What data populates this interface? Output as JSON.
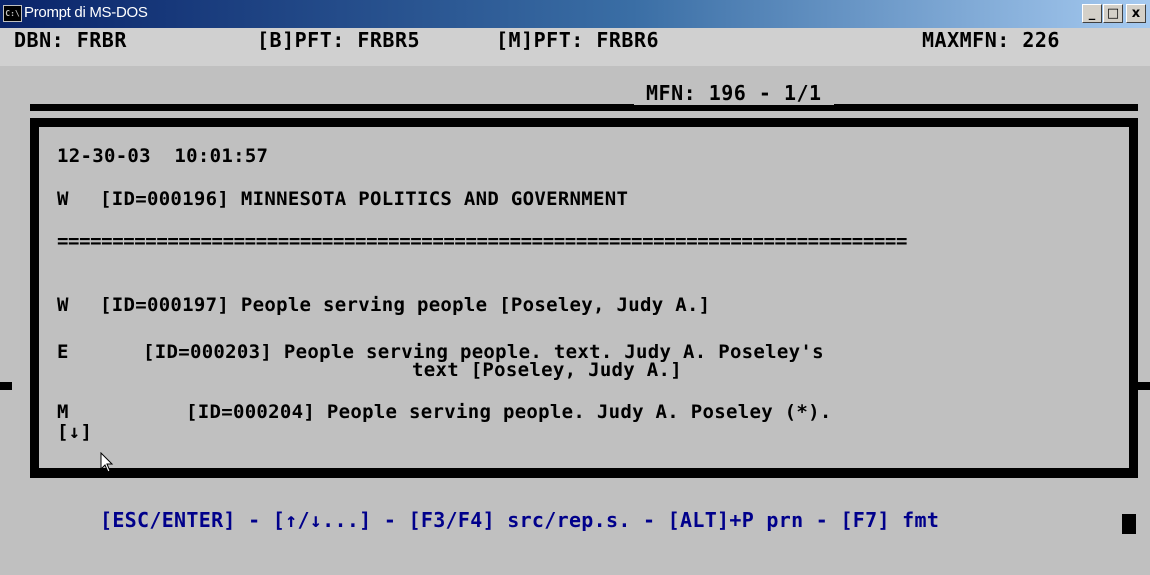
{
  "window": {
    "title": "Prompt di MS-DOS",
    "icon": "msdos-icon",
    "controls": {
      "minimize": "_",
      "maximize": "□",
      "close": "x"
    }
  },
  "header": {
    "dbn": "DBN: FRBR",
    "bpft": "[B]PFT: FRBR5",
    "mpft": "[M]PFT: FRBR6",
    "maxmfn": "MAXMFN: 226"
  },
  "mfn_indicator": "MFN: 196 - 1/1",
  "record": {
    "datetime": "12-30-03  10:01:57",
    "title_type": "W",
    "title_entry": "[ID=000196] MINNESOTA POLITICS AND GOVERNMENT",
    "separator": "=============================================================================",
    "rows": [
      {
        "type": "W",
        "text": "[ID=000197] People serving people [Poseley, Judy A.]"
      },
      {
        "type": "E",
        "text": "[ID=000203] People serving people. text. Judy A. Poseley's",
        "continuation": "text [Poseley, Judy A.]"
      },
      {
        "type": "M",
        "text": "[ID=000204] People serving people. Judy A. Poseley (*)."
      }
    ],
    "more_indicator": "[↓]"
  },
  "footer": {
    "keys": "[ESC/ENTER] - [↑/↓...] - [F3/F4] src/rep.s. - [ALT]+P prn - [F7] fmt"
  }
}
